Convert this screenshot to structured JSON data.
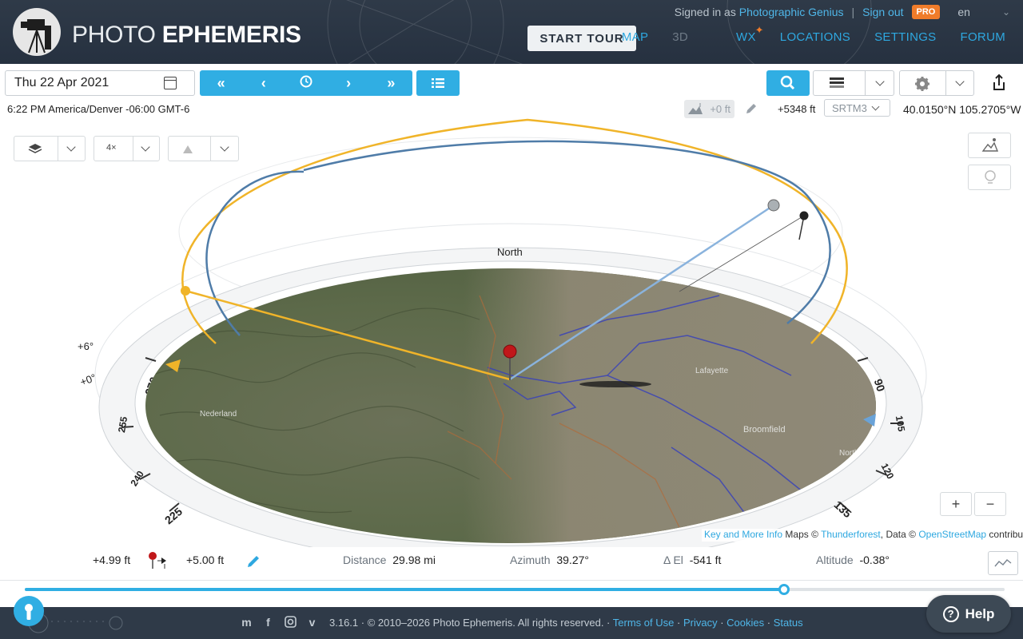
{
  "header": {
    "brand_light": "PHOTO",
    "brand_bold": "EPHEMERIS",
    "signed_in_prefix": "Signed in as",
    "user_name": "Photographic Genius",
    "separator": "|",
    "sign_out": "Sign out",
    "pro_badge": "PRO",
    "language": "en",
    "start_tour": "START TOUR",
    "nav": [
      "MAP",
      "3D",
      "WX",
      "LOCATIONS",
      "SETTINGS",
      "FORUM"
    ],
    "nav_active": "3D"
  },
  "toolbar": {
    "date": "Thu 22 Apr 2021",
    "timezone": "6:22 PM America/Denver -06:00 GMT-6",
    "height_offset": "+0 ft",
    "elevation": "+5348 ft",
    "dem_source": "SRTM3",
    "coordinates": "40.0150°N 105.2705°W",
    "zoom_factor": "4×"
  },
  "scene": {
    "north_label": "North",
    "horizon_labels": [
      "+6°",
      "+0°"
    ],
    "compass_labels": [
      "270",
      "255",
      "240",
      "225",
      "90",
      "105",
      "120",
      "135"
    ],
    "place_labels": [
      "Nederland",
      "Lafayette",
      "Broomfield",
      "North"
    ]
  },
  "map_attribution": {
    "key_link": "Key and More Info",
    "maps_text": "Maps ©",
    "tf_link": "Thunderforest",
    "data_text": ", Data ©",
    "osm_link": "OpenStreetMap",
    "contrib": "contributors"
  },
  "info_bar": {
    "observer_height": "+4.99 ft",
    "target_height": "+5.00 ft",
    "distance_label": "Distance",
    "distance_value": "29.98 mi",
    "azimuth_label": "Azimuth",
    "azimuth_value": "39.27°",
    "delta_el_label": "Δ El",
    "delta_el_value": "-541 ft",
    "altitude_label": "Altitude",
    "altitude_value": "-0.38°"
  },
  "timeline": {
    "progress": 0.775
  },
  "footer": {
    "version": "3.16.1 · © 2010–2026 Photo Ephemeris. All rights reserved. ·",
    "links": [
      "Terms of Use",
      "Privacy",
      "Cookies",
      "Status"
    ],
    "link_sep": "·",
    "help": "Help"
  },
  "colors": {
    "accent": "#30aee3",
    "header_bg": "#2f3a48",
    "sun_path": "#f0b429",
    "moon_path": "#4f7ca8",
    "pro": "#f07c2a"
  },
  "icons": [
    "camera-logo-icon",
    "calendar-icon",
    "double-left-icon",
    "left-icon",
    "clock-icon",
    "right-icon",
    "double-right-icon",
    "list-icon",
    "search-icon",
    "map-style-icon",
    "gear-icon",
    "share-icon",
    "layers-icon",
    "terrain-icon",
    "pencil-icon",
    "pin-icon",
    "graph-icon",
    "lock-icon",
    "help-icon"
  ]
}
